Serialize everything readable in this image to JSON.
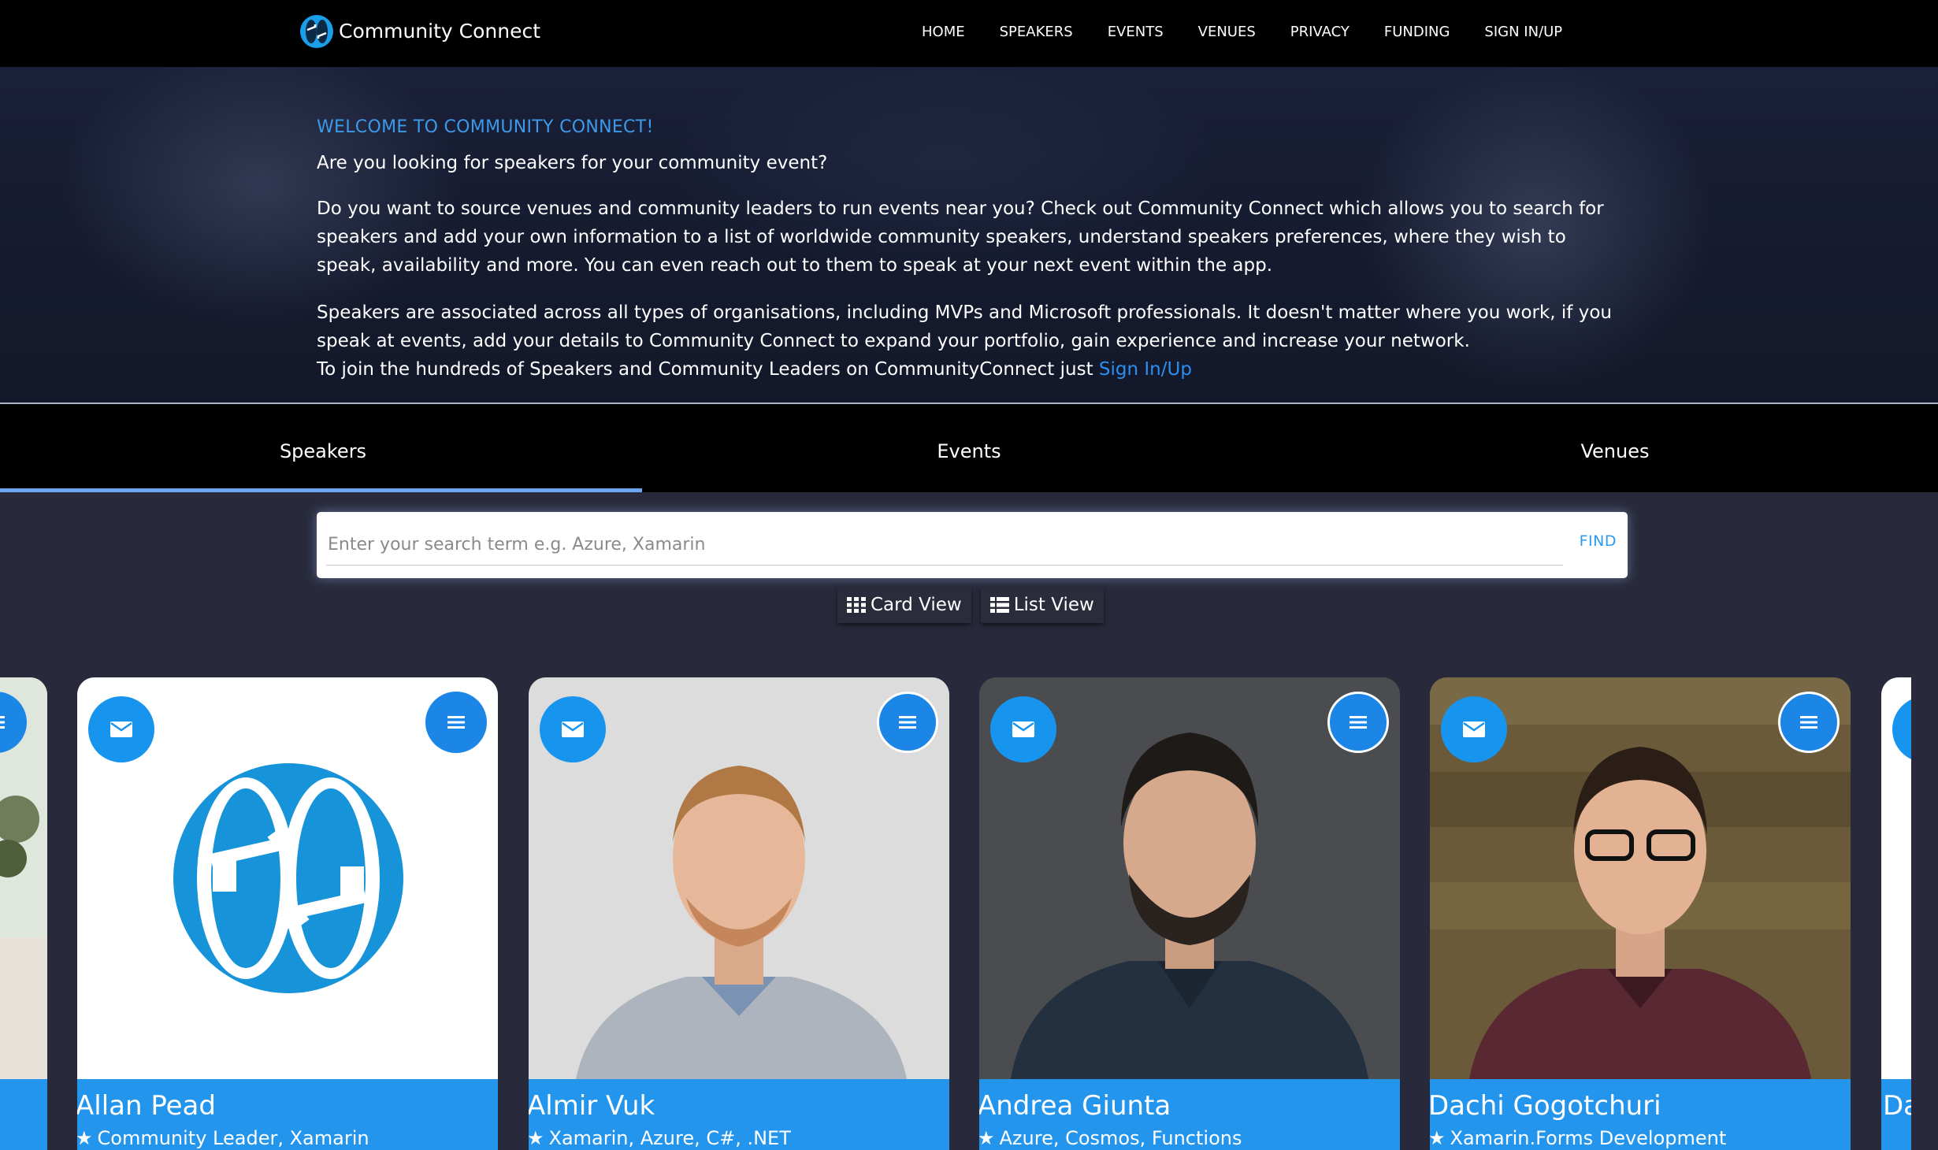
{
  "brand": {
    "name": "Community Connect",
    "logo_icon": "community-connect-logo-icon",
    "accent_color": "#1b9ee8"
  },
  "nav": {
    "items": [
      {
        "label": "HOME"
      },
      {
        "label": "SPEAKERS"
      },
      {
        "label": "EVENTS"
      },
      {
        "label": "VENUES"
      },
      {
        "label": "PRIVACY"
      },
      {
        "label": "FUNDING"
      },
      {
        "label": "SIGN IN/UP"
      }
    ]
  },
  "hero": {
    "heading": "WELCOME TO COMMUNITY CONNECT!",
    "question": "Are you looking for speakers for your community event?",
    "paragraph1": "Do you want to source venues and community leaders to run events near you? Check out Community Connect which allows you to search for speakers and add your own information to a list of worldwide community speakers, understand speakers preferences, where they wish to speak, availability and more. You can even reach out to them to speak at your next event within the app.",
    "paragraph2": "Speakers are associated across all types of organisations, including MVPs and Microsoft professionals. It doesn't matter where you work, if you speak at events, add your details to Community Connect to expand your portfolio, gain experience and increase your network.",
    "join_text": "To join the hundreds of Speakers and Community Leaders on CommunityConnect just ",
    "join_link": "Sign In/Up"
  },
  "tabs": {
    "items": [
      {
        "label": "Speakers",
        "active": true
      },
      {
        "label": "Events",
        "active": false
      },
      {
        "label": "Venues",
        "active": false
      }
    ]
  },
  "search": {
    "placeholder": "Enter your search term e.g. Azure, Xamarin",
    "value": "",
    "find_label": "FIND"
  },
  "views": {
    "card_view_label": "Card View",
    "list_view_label": "List View",
    "card_view_icon": "grid-icon",
    "list_view_icon": "list-icon"
  },
  "speakers": [
    {
      "name": "Allan Pead",
      "tags": "Community Leader, Xamarin"
    },
    {
      "name": "Almir Vuk",
      "tags": "Xamarin, Azure, C#, .NET"
    },
    {
      "name": "Andrea Giunta",
      "tags": "Azure, Cosmos, Functions"
    },
    {
      "name": "Dachi Gogotchuri",
      "tags": "Xamarin.Forms Development"
    }
  ],
  "partial_right_card": {
    "name_fragment": "Da"
  },
  "card_icons": {
    "mail": "mail-icon",
    "menu": "menu-icon",
    "tag": "star-icon"
  }
}
